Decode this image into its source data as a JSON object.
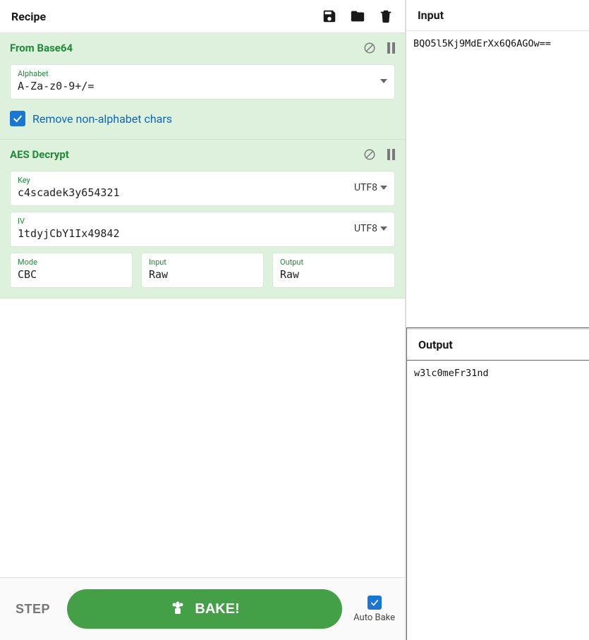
{
  "header": {
    "recipe_title": "Recipe",
    "input_title": "Input",
    "output_title": "Output"
  },
  "op1": {
    "title": "From Base64",
    "alphabet_label": "Alphabet",
    "alphabet_value": "A-Za-z0-9+/=",
    "remove_label": "Remove non-alphabet chars"
  },
  "op2": {
    "title": "AES Decrypt",
    "key_label": "Key",
    "key_value": "c4scadek3y654321",
    "key_enc": "UTF8",
    "iv_label": "IV",
    "iv_value": "1tdyjCbY1Ix49842",
    "iv_enc": "UTF8",
    "mode_label": "Mode",
    "mode_value": "CBC",
    "input_label": "Input",
    "input_value": "Raw",
    "output_label": "Output",
    "output_value": "Raw"
  },
  "footer": {
    "step": "STEP",
    "bake": "BAKE!",
    "autobake": "Auto Bake"
  },
  "io": {
    "input": "BQO5l5Kj9MdErXx6Q6AGOw==",
    "output": "w3lc0meFr31nd"
  }
}
